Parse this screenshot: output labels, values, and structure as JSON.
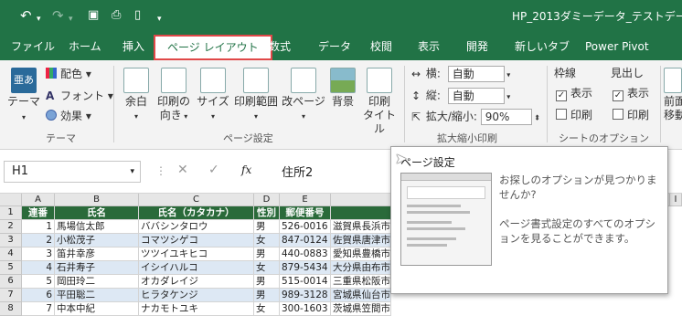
{
  "titlebar": {
    "title": "HP_2013ダミーデータ_テストデータ用"
  },
  "tabs": [
    {
      "label": "ファイル"
    },
    {
      "label": "ホーム"
    },
    {
      "label": "挿入"
    },
    {
      "label": "ページ レイアウト"
    },
    {
      "label": "数式"
    },
    {
      "label": "データ"
    },
    {
      "label": "校閲"
    },
    {
      "label": "表示"
    },
    {
      "label": "開発"
    },
    {
      "label": "新しいタブ"
    },
    {
      "label": "Power Pivot"
    }
  ],
  "ribbon": {
    "theme": {
      "label": "テーマ",
      "colors": "配色",
      "fonts": "フォント",
      "effects": "効果",
      "group": "テーマ"
    },
    "page_setup": {
      "margins": "余白",
      "orientation1": "印刷の",
      "orientation2": "向き",
      "size": "サイズ",
      "print_area": "印刷範囲",
      "breaks": "改ページ",
      "background": "背景",
      "titles1": "印刷",
      "titles2": "タイトル",
      "group": "ページ設定"
    },
    "scale": {
      "width_label": "横:",
      "width_value": "自動",
      "height_label": "縦:",
      "height_value": "自動",
      "scale_label": "拡大/縮小:",
      "scale_value": "90%",
      "group": "拡大縮小印刷"
    },
    "sheet_options": {
      "gridlines": "枠線",
      "headings": "見出し",
      "view": "表示",
      "print": "印刷",
      "group": "シートのオプション"
    },
    "arrange": {
      "front1": "前面",
      "front2": "移動"
    }
  },
  "formula_bar": {
    "name_box": "H1",
    "fx": "fx",
    "content": "住所2"
  },
  "columns": [
    "A",
    "B",
    "C",
    "D",
    "E"
  ],
  "col_i": "I",
  "rows": [
    "1",
    "2",
    "3",
    "4",
    "5",
    "6",
    "7",
    "8"
  ],
  "table": {
    "headers": [
      "連番",
      "氏名",
      "氏名（カタカナ）",
      "性別",
      "郵便番号"
    ],
    "data": [
      [
        "1",
        "馬場信太郎",
        "ババシンタロウ",
        "男",
        "526-0016",
        "滋賀県長浜市"
      ],
      [
        "2",
        "小松茂子",
        "コマツシゲコ",
        "女",
        "847-0124",
        "佐賀県唐津市"
      ],
      [
        "3",
        "笛井幸彦",
        "ツツイユキヒコ",
        "男",
        "440-0883",
        "愛知県豊橋市"
      ],
      [
        "4",
        "石井寿子",
        "イシイハルコ",
        "女",
        "879-5434",
        "大分県由布市"
      ],
      [
        "5",
        "岡田玲二",
        "オカダレイジ",
        "男",
        "515-0014",
        "三重県松阪市"
      ],
      [
        "6",
        "平田聡二",
        "ヒラタケンジ",
        "男",
        "989-3128",
        "宮城県仙台市"
      ],
      [
        "7",
        "中本中紀",
        "ナカモトユキ",
        "女",
        "300-1603",
        "茨城県笠間市"
      ]
    ]
  },
  "tooltip": {
    "title": "ページ設定",
    "text1": "お探しのオプションが見つかりませんか?",
    "text2": "ページ書式設定のすべてのオプションを見ることができます。"
  },
  "colors": {
    "excel_green": "#217346",
    "header_fill": "#2a6a3a",
    "highlight_red": "#e04848",
    "row_blue": "#dde8f4"
  }
}
